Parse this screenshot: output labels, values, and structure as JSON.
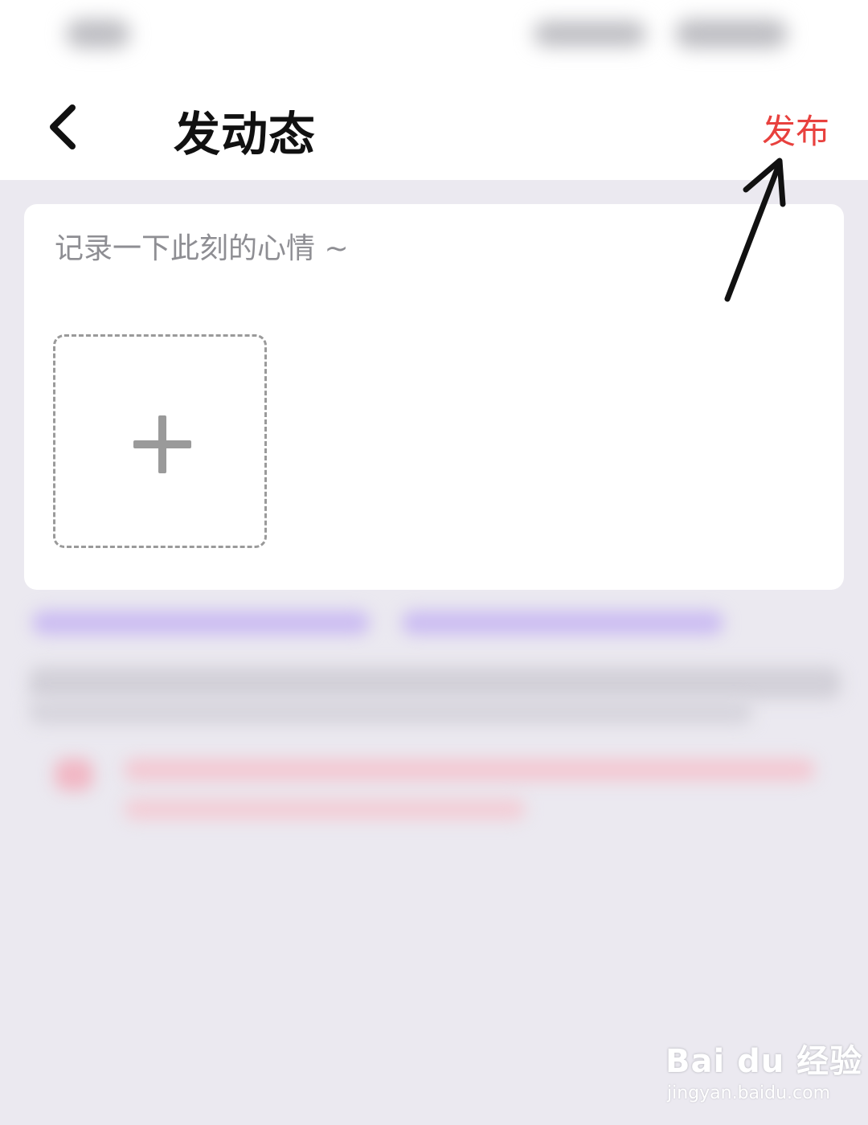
{
  "header": {
    "title": "发动态",
    "publish_label": "发布"
  },
  "composer": {
    "placeholder": "记录一下此刻的心情 ~"
  },
  "watermark": {
    "logo": "Bai du 经验",
    "url": "jingyan.baidu.com"
  },
  "colors": {
    "publish": "#e8413e",
    "background": "#ebe9f0",
    "card": "#ffffff",
    "dashed_border": "#9a9a9a"
  },
  "icons": {
    "back": "chevron-left-icon",
    "add": "plus-icon"
  }
}
